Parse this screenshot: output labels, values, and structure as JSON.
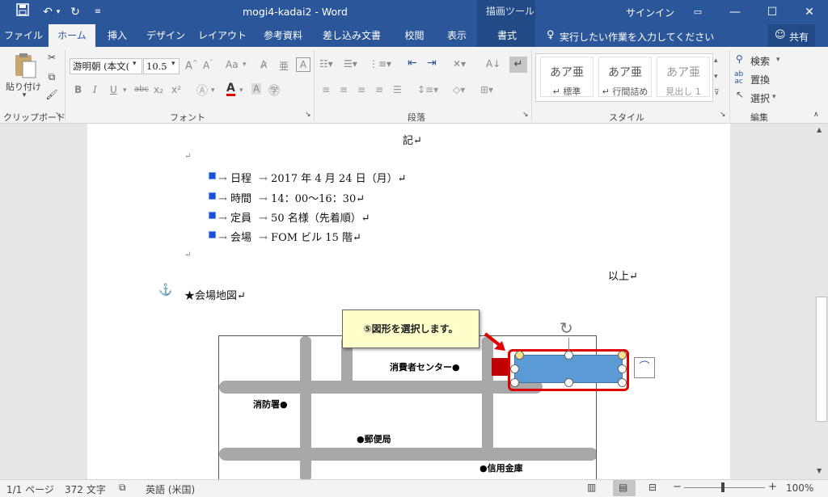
{
  "window": {
    "title": "mogi4-kadai2 - Word",
    "context_tab": "描画ツール",
    "signin": "サインイン"
  },
  "tabs": [
    {
      "label": "ファイル"
    },
    {
      "label": "ホーム"
    },
    {
      "label": "挿入"
    },
    {
      "label": "デザイン"
    },
    {
      "label": "レイアウト"
    },
    {
      "label": "参考資料"
    },
    {
      "label": "差し込み文書"
    },
    {
      "label": "校閲"
    },
    {
      "label": "表示"
    },
    {
      "label": "書式"
    }
  ],
  "tellme": "実行したい作業を入力してください",
  "share": "共有",
  "ribbon": {
    "clipboard": {
      "paste": "貼り付け",
      "group": "クリップボード"
    },
    "font": {
      "name": "游明朝 (本文(",
      "size": "10.5",
      "group": "フォント",
      "aa": "Aa",
      "bold": "B",
      "italic": "I",
      "underline": "U",
      "strike": "abc",
      "sub": "x₂",
      "sup": "x²",
      "fontcolor": "A"
    },
    "paragraph": {
      "group": "段落"
    },
    "styles": {
      "items": [
        {
          "sample": "あア亜",
          "label": "↵ 標準"
        },
        {
          "sample": "あア亜",
          "label": "↵ 行間詰め"
        },
        {
          "sample": "あア亜",
          "label": "見出し 1"
        }
      ],
      "group": "スタイル"
    },
    "editing": {
      "find": "検索",
      "replace": "置換",
      "select": "選択",
      "group": "編集"
    }
  },
  "doc": {
    "ki": "記↵",
    "ret": "↵",
    "items": [
      {
        "label": "日程",
        "value": "2017 年 4 月 24 日（月）↵"
      },
      {
        "label": "時間",
        "value": "14：00〜16：30↵"
      },
      {
        "label": "定員",
        "value": "50 名様（先着順）↵"
      },
      {
        "label": "会場",
        "value": "FOM ビル 15 階↵"
      }
    ],
    "ijou": "以上↵",
    "map_heading": "★会場地図↵",
    "callout": "⑤図形を選択します。",
    "map_labels": {
      "consumer": "消費者センター●",
      "fire": "消防署●",
      "post": "●郵便局",
      "bank": "●信用金庫"
    }
  },
  "status": {
    "page": "1/1 ページ",
    "words": "372 文字",
    "lang": "英語 (米国)",
    "zoom": "100%"
  },
  "colors": {
    "brand": "#2b579a",
    "shape_fill": "#5b9bd5",
    "highlight": "#e00000",
    "marker": "#c00000"
  }
}
